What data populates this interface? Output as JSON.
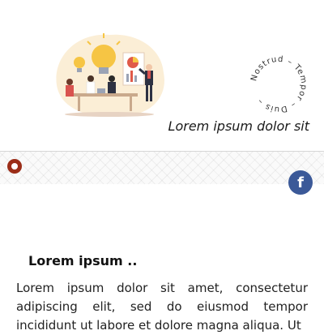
{
  "hero": {
    "illustration_name": "business-meeting-lightbulb-illustration",
    "circle_text": "Nostrud – Tempor – Duis –",
    "tagline": "Lorem ipsum dolor sit"
  },
  "social": {
    "facebook_icon": "facebook-icon",
    "facebook_glyph": "f"
  },
  "content": {
    "title": "Lorem ipsum ..",
    "paragraph": "Lorem ipsum dolor sit amet, consectetur adipiscing elit, sed do eiusmod tempor incididunt ut labore et dolore magna aliqua. Ut"
  },
  "colors": {
    "accent": "#9b2d18",
    "facebook": "#3b5998",
    "blob": "#fbeed6"
  }
}
